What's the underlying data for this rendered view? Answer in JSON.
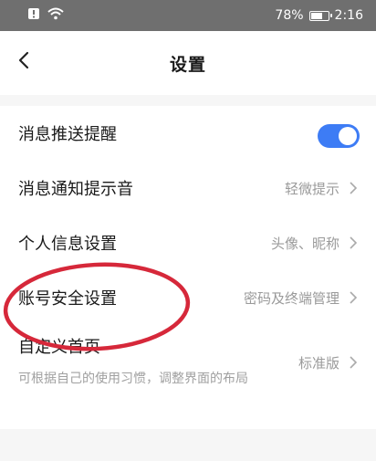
{
  "status_bar": {
    "battery_text": "78%",
    "battery_level": 0.78,
    "time": "2:16",
    "icons": [
      "alert-icon",
      "wifi-icon",
      "battery-icon"
    ]
  },
  "header": {
    "title": "设置"
  },
  "settings": [
    {
      "label": "消息推送提醒",
      "type": "toggle",
      "on": true
    },
    {
      "label": "消息通知提示音",
      "value": "轻微提示"
    },
    {
      "label": "个人信息设置",
      "value": "头像、昵称"
    },
    {
      "label": "账号安全设置",
      "value": "密码及终端管理"
    },
    {
      "label": "自定义首页",
      "subtext": "可根据自己的使用习惯，调整界面的布局",
      "value": "标准版"
    }
  ],
  "colors": {
    "toggle_on": "#3d7cf5",
    "annotation": "#d6283a",
    "status_bar": "#6f6f6f"
  }
}
